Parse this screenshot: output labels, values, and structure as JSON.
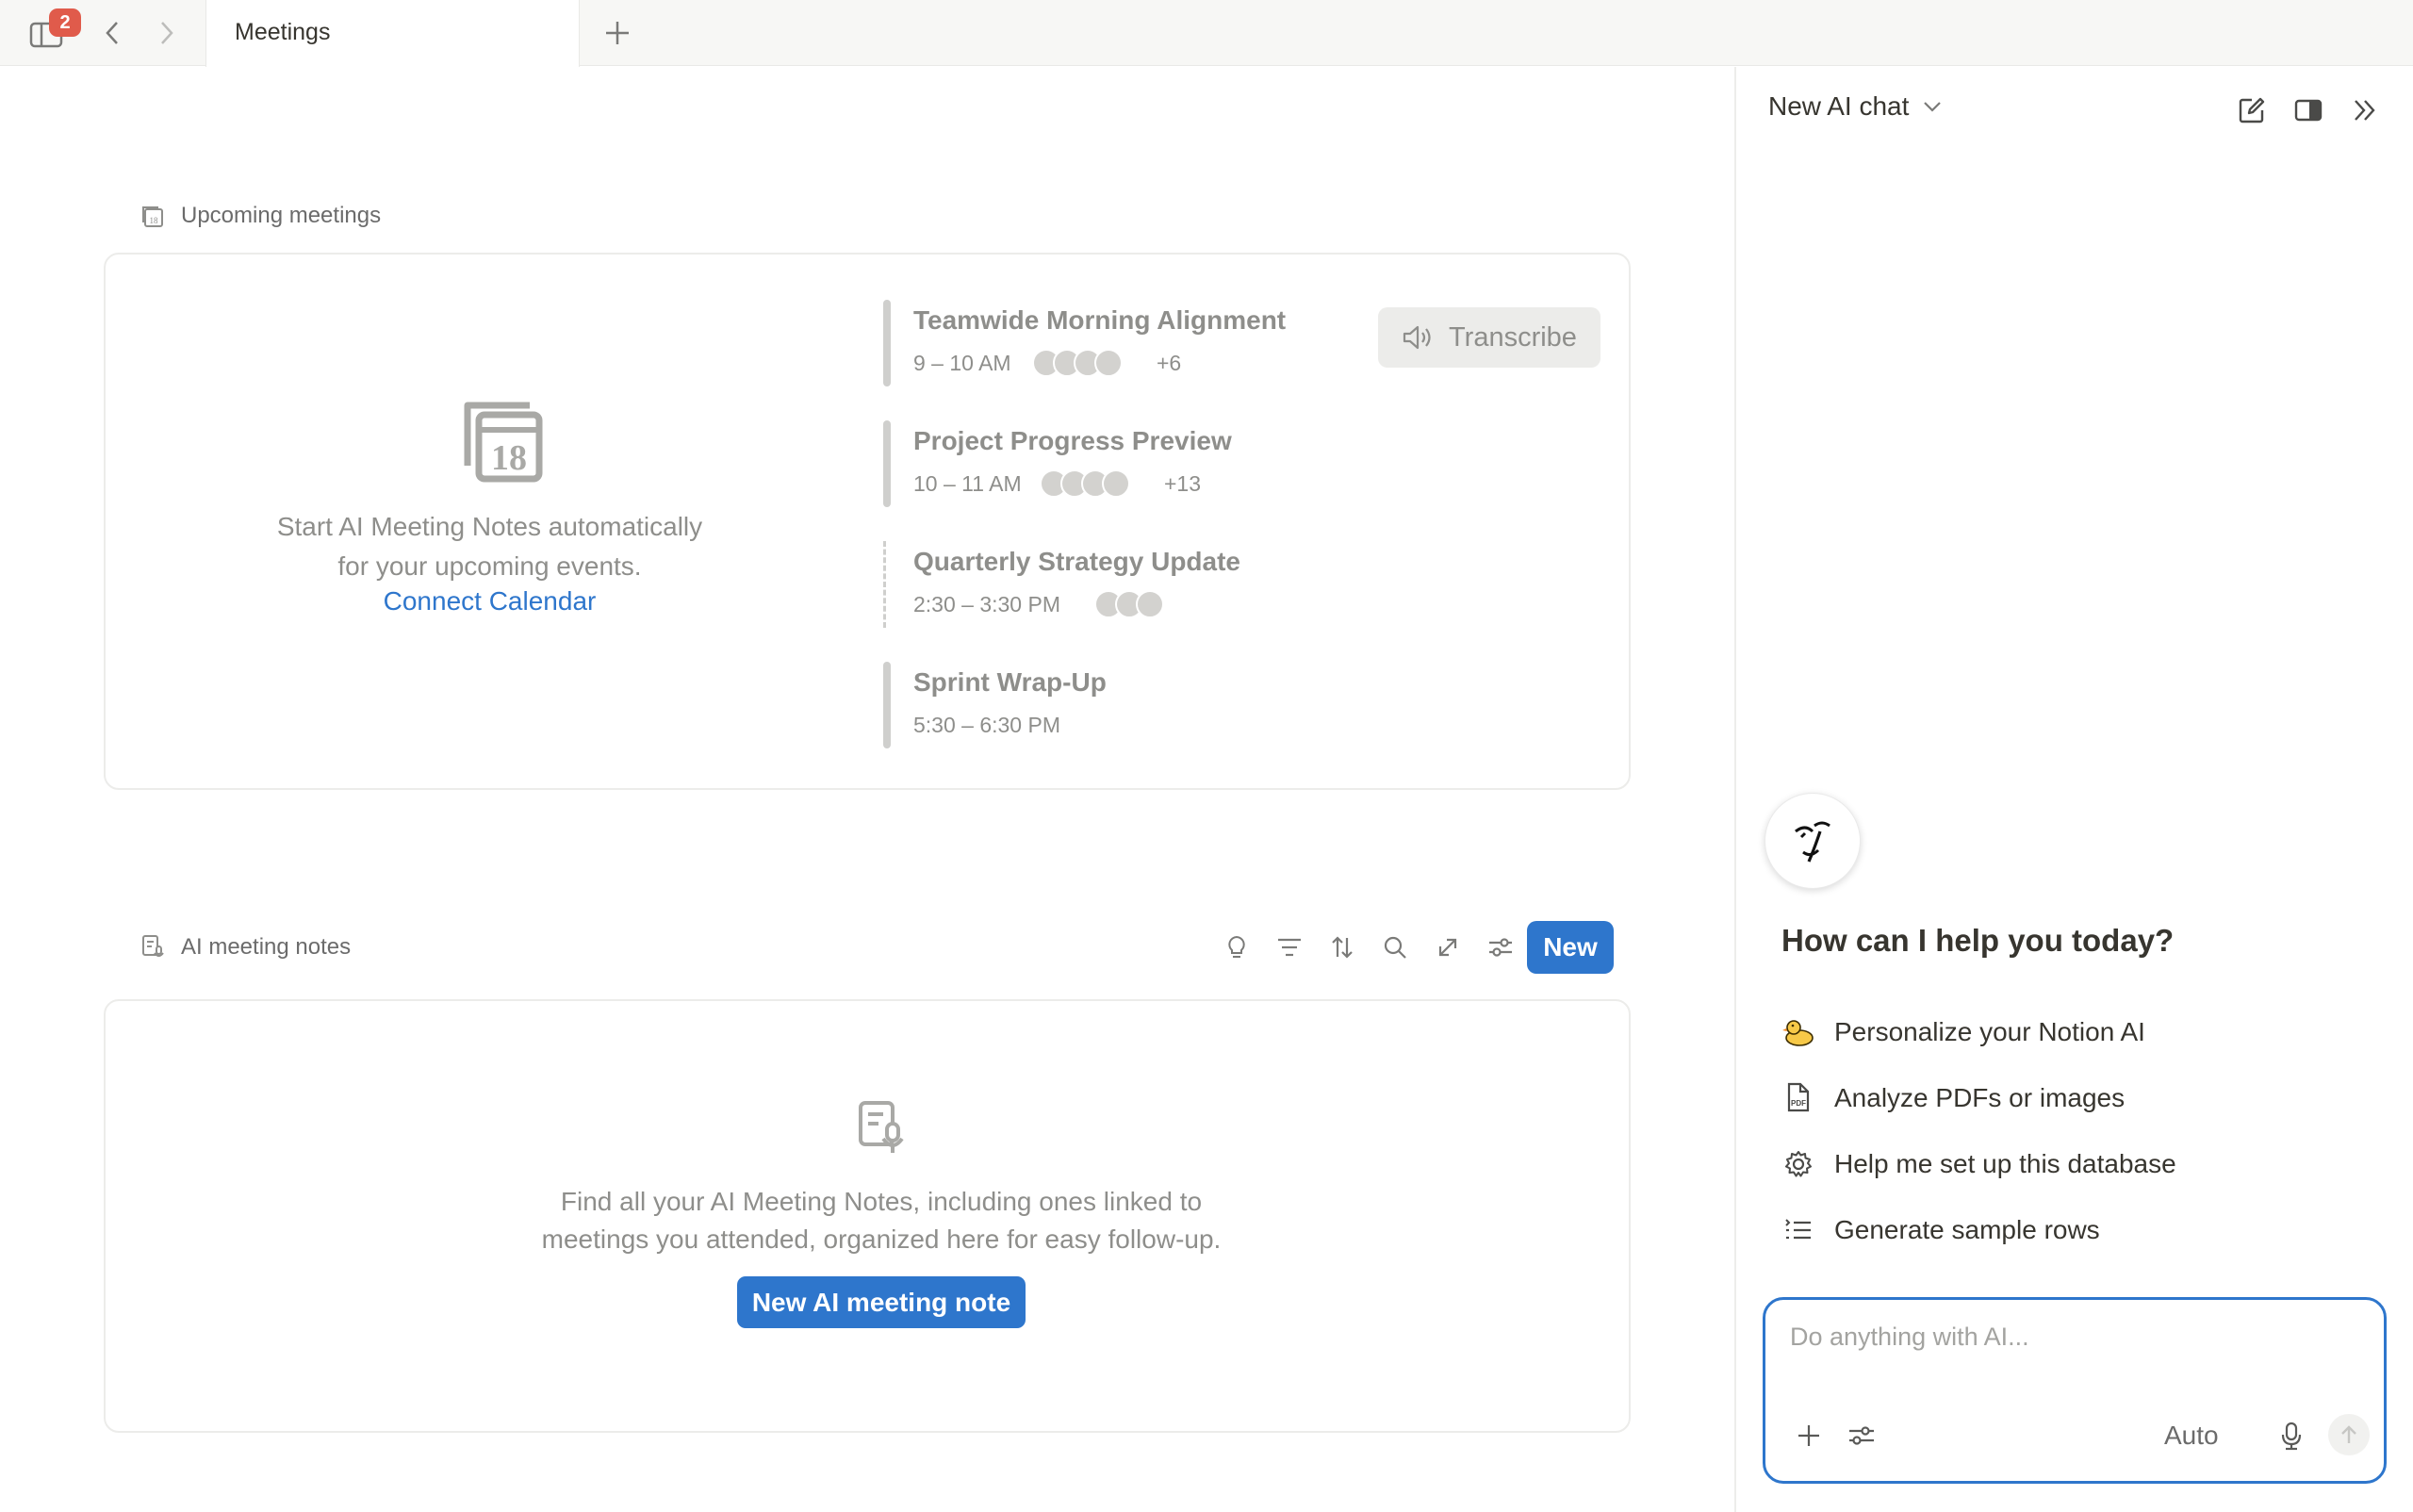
{
  "tabbar": {
    "badge_count": "2",
    "tab_title": "Meetings"
  },
  "upcoming": {
    "heading": "Upcoming meetings",
    "empty_line1": "Start AI Meeting Notes automatically",
    "empty_line2": "for your upcoming events.",
    "connect_label": "Connect Calendar",
    "transcribe_label": "Transcribe",
    "meetings": [
      {
        "title": "Teamwide Morning Alignment",
        "time": "9 – 10 AM",
        "avatars": 4,
        "extra": "+6",
        "tentative": false
      },
      {
        "title": "Project Progress Preview",
        "time": "10 – 11 AM",
        "avatars": 4,
        "extra": "+13",
        "tentative": false
      },
      {
        "title": "Quarterly Strategy Update",
        "time": "2:30 – 3:30 PM",
        "avatars": 3,
        "extra": "",
        "tentative": true
      },
      {
        "title": "Sprint Wrap-Up",
        "time": "5:30 – 6:30 PM",
        "avatars": 0,
        "extra": "",
        "tentative": false
      }
    ]
  },
  "notes": {
    "heading": "AI meeting notes",
    "new_label": "New",
    "empty_line1": "Find all your AI Meeting Notes, including ones linked to",
    "empty_line2": "meetings you attended, organized here for easy follow-up.",
    "new_note_label": "New AI meeting note",
    "toolbar_icons": [
      "lightbulb-icon",
      "filter-icon",
      "sort-icon",
      "search-icon",
      "expand-icon",
      "settings-sliders-icon"
    ]
  },
  "ai": {
    "title": "New AI chat",
    "greeting": "How can I help you today?",
    "suggestions": [
      {
        "icon": "duck-icon",
        "label": "Personalize your Notion AI"
      },
      {
        "icon": "pdf-icon",
        "label": "Analyze PDFs or images"
      },
      {
        "icon": "gear-icon",
        "label": "Help me set up this database"
      },
      {
        "icon": "list-icon",
        "label": "Generate sample rows"
      }
    ],
    "input_placeholder": "Do anything with AI...",
    "mode_label": "Auto"
  },
  "colors": {
    "accent": "#2e76cc",
    "badge": "#e05b4b",
    "muted_text": "#8e8e8b"
  }
}
